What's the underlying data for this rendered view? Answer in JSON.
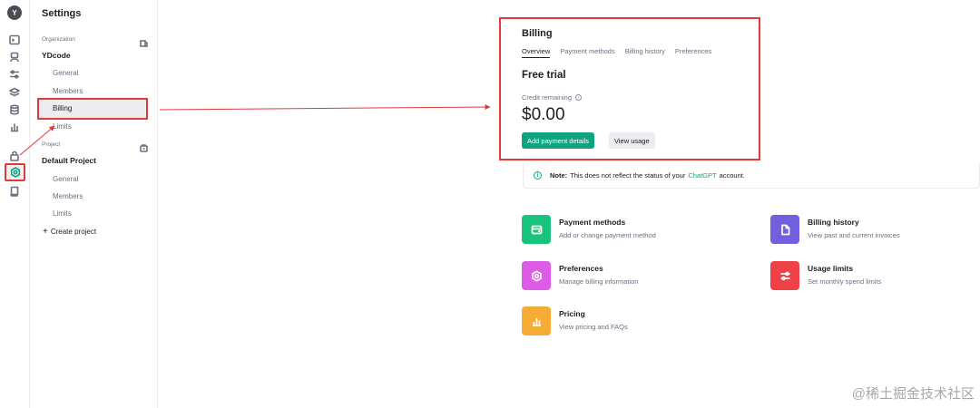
{
  "rail": {
    "avatar_letter": "Y",
    "icons": [
      "terminal-icon",
      "assistant-icon",
      "tune-icon",
      "storage-icon",
      "database-icon",
      "chart-icon",
      "lock-icon",
      "gear-icon",
      "book-icon"
    ]
  },
  "sidebar": {
    "title": "Settings",
    "organization_label": "Organization",
    "organization_name": "YDcode",
    "org_items": [
      "General",
      "Members",
      "Billing",
      "Limits"
    ],
    "project_label": "Project",
    "project_name": "Default Project",
    "project_items": [
      "General",
      "Members",
      "Limits"
    ],
    "create_project": "Create project"
  },
  "billing": {
    "title": "Billing",
    "tabs": [
      "Overview",
      "Payment methods",
      "Billing history",
      "Preferences"
    ],
    "plan": "Free trial",
    "credit_label": "Credit remaining",
    "credit_amount": "$0.00",
    "add_payment_label": "Add payment details",
    "view_usage_label": "View usage"
  },
  "note": {
    "label": "Note:",
    "text_before": "This does not reflect the status of your",
    "link": "ChatGPT",
    "text_after": "account."
  },
  "cards": [
    {
      "title": "Payment methods",
      "desc": "Add or change payment method",
      "color": "#19c37d",
      "icon": "credit-card-icon"
    },
    {
      "title": "Billing history",
      "desc": "View past and current invoices",
      "color": "#715fde",
      "icon": "document-icon"
    },
    {
      "title": "Preferences",
      "desc": "Manage billing information",
      "color": "#dd5ce5",
      "icon": "gear-icon"
    },
    {
      "title": "Usage limits",
      "desc": "Set monthly spend limits",
      "color": "#ef4146",
      "icon": "sliders-icon"
    },
    {
      "title": "Pricing",
      "desc": "View pricing and FAQs",
      "color": "#f4ac36",
      "icon": "chart-icon"
    }
  ],
  "colors": {
    "accent": "#10a37f",
    "annotation": "#e03a3a"
  },
  "watermark": "@稀土掘金技术社区"
}
